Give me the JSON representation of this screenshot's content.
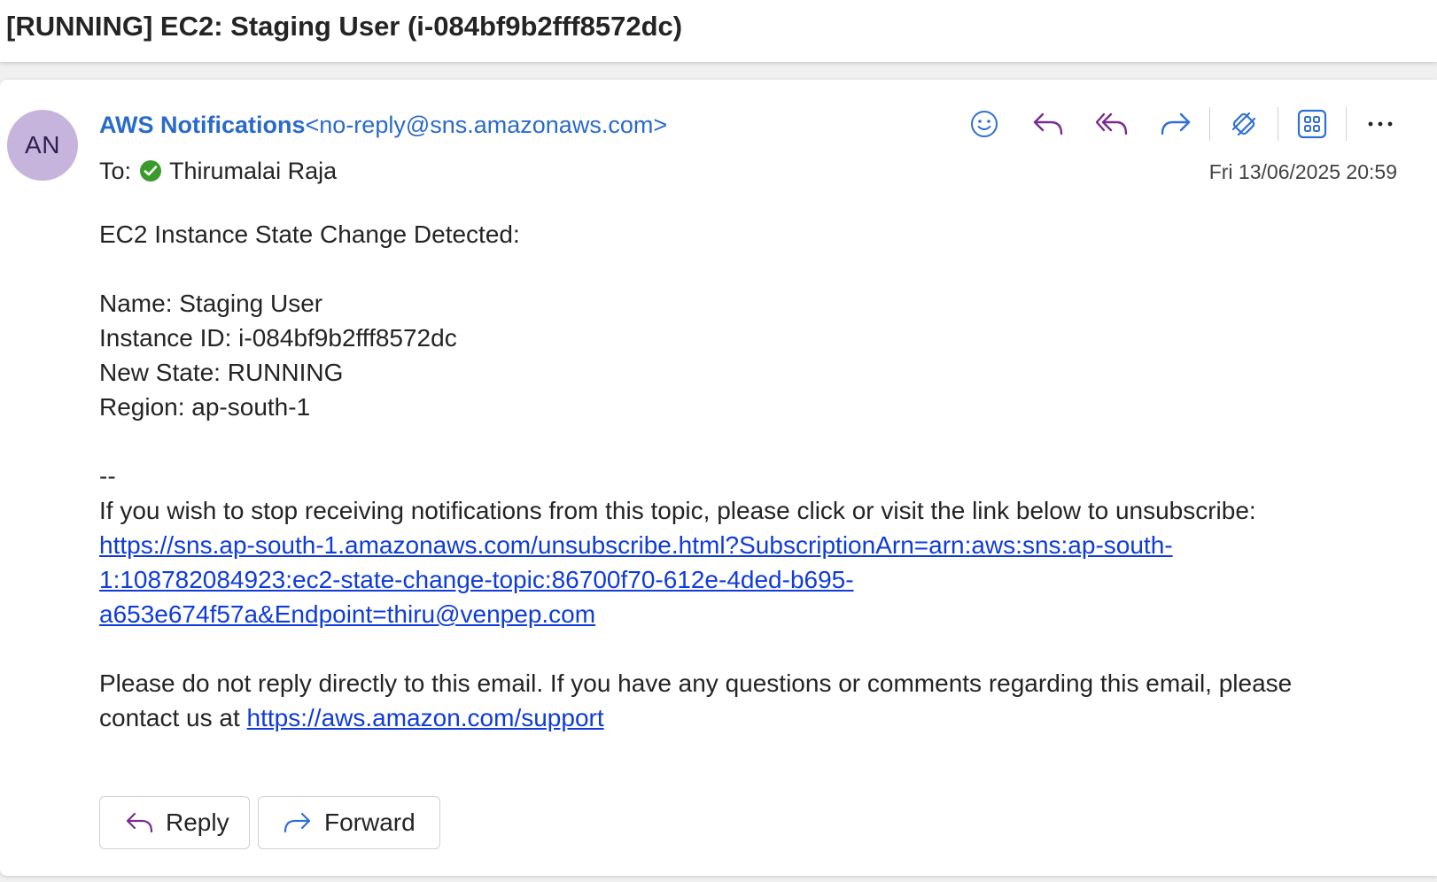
{
  "subject": "[RUNNING] EC2: Staging User (i-084bf9b2fff8572dc)",
  "message": {
    "avatar_initials": "AN",
    "sender_name": "AWS Notifications",
    "sender_email": "<no-reply@sns.amazonaws.com>",
    "to_label": "To:",
    "to_name": "Thirumalai Raja",
    "date": "Fri 13/06/2025 20:59"
  },
  "toolbar": {
    "icons": [
      "emoji-icon",
      "reply-icon",
      "reply-all-icon",
      "forward-icon",
      "immersive-reader-icon",
      "apps-icon",
      "more-icon"
    ]
  },
  "body": {
    "heading": "EC2 Instance State Change Detected:",
    "name_line": "Name: Staging User",
    "instance_line": "Instance ID: i-084bf9b2fff8572dc",
    "state_line": "New State: RUNNING",
    "region_line": "Region: ap-south-1",
    "separator": "--",
    "unsubscribe_text": "If you wish to stop receiving notifications from this topic, please click or visit the link below to unsubscribe:",
    "unsubscribe_link_1": "https://sns.ap-south-1.amazonaws.com/unsubscribe.html?SubscriptionArn=arn:aws:sns:ap-south-",
    "unsubscribe_link_2": "1:108782084923:ec2-state-change-topic:86700f70-612e-4ded-b695-",
    "unsubscribe_link_3": "a653e674f57a&Endpoint=thiru@venpep.com",
    "noreply_text_1": "Please do not reply directly to this email. If you have any questions or comments regarding this email, please",
    "noreply_text_2": "contact us at ",
    "support_link": "https://aws.amazon.com/support"
  },
  "actions": {
    "reply_label": "Reply",
    "forward_label": "Forward"
  },
  "colors": {
    "link": "#0f3cd9",
    "sender": "#2a6bc9",
    "accent_purple": "#7a2b8f",
    "accent_blue": "#2f6fd6",
    "avatar_bg": "#c7b4dd"
  }
}
